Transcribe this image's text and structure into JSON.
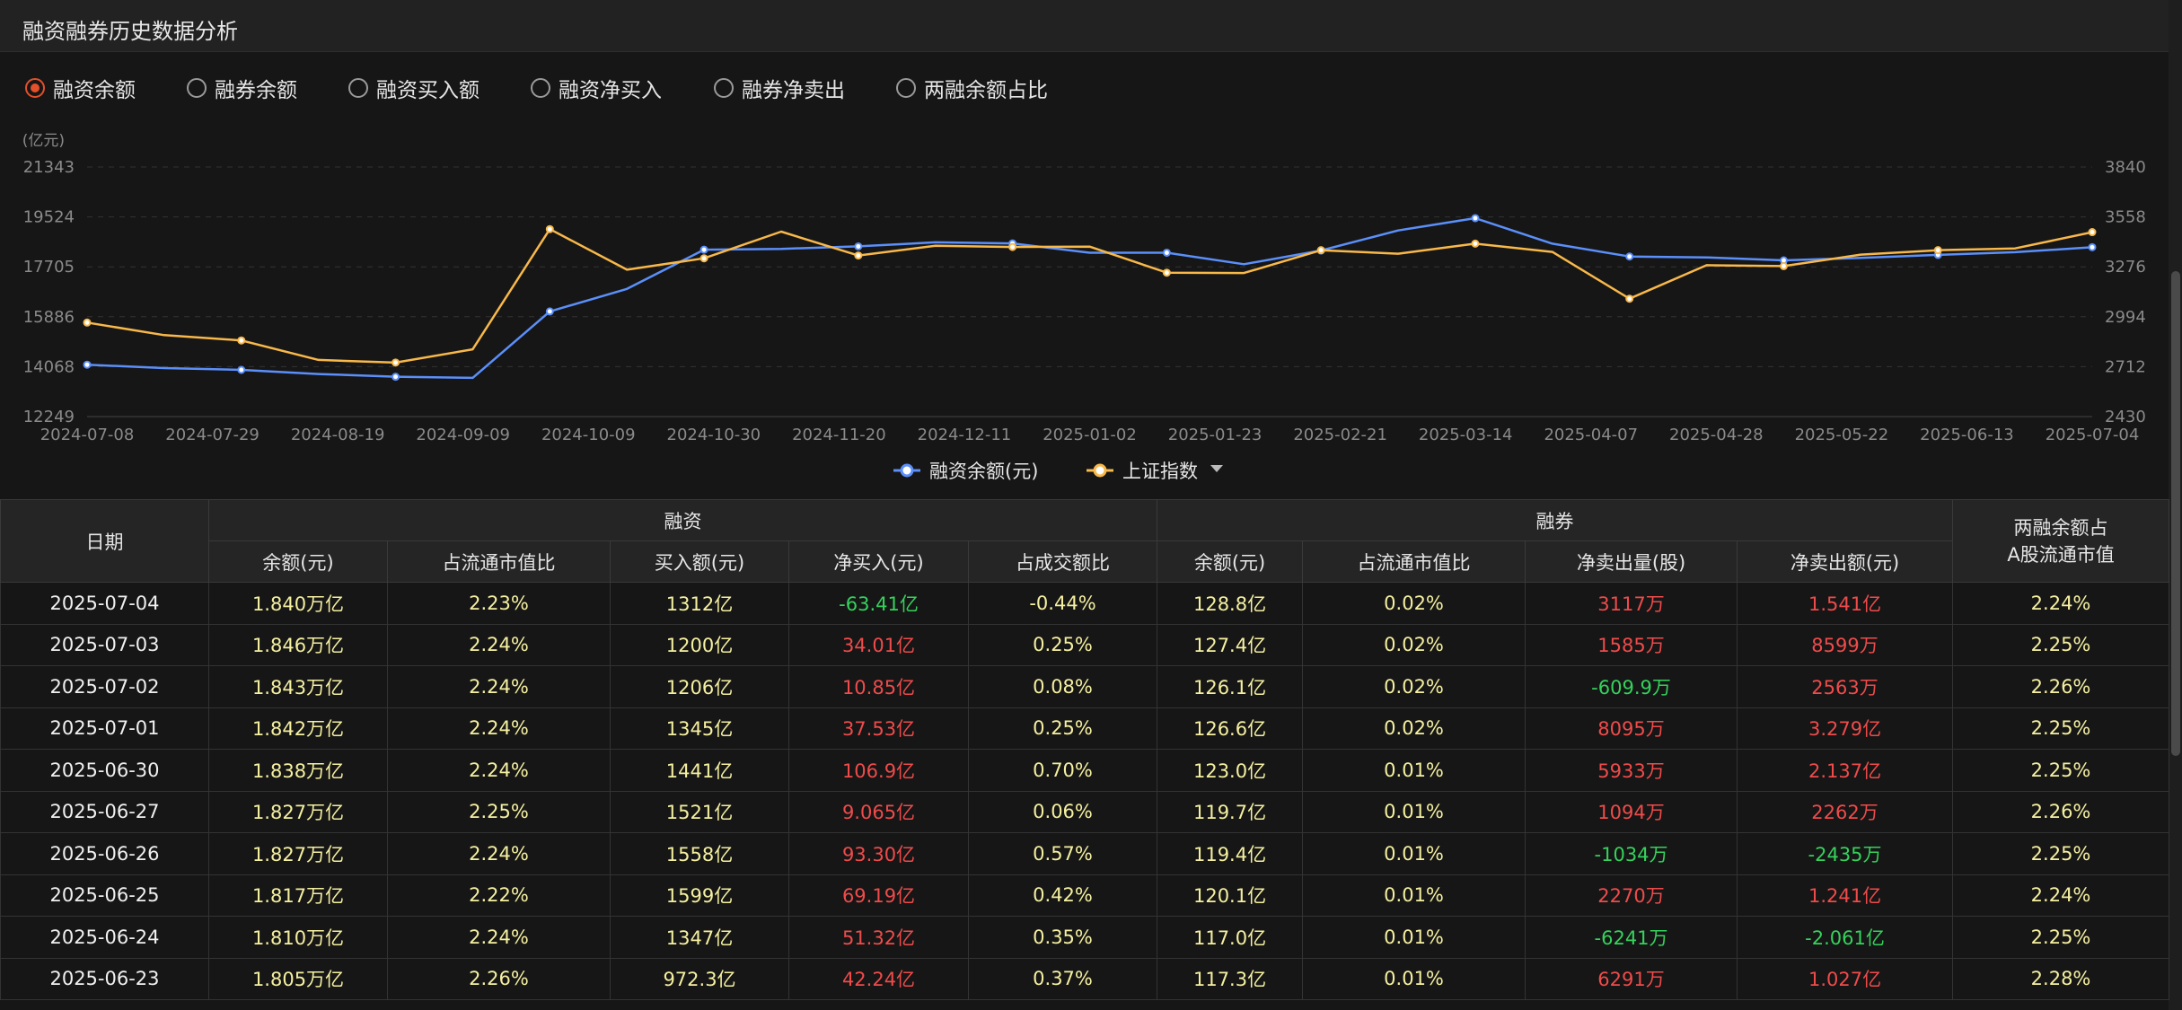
{
  "header": {
    "title": "融资融券历史数据分析"
  },
  "tabs": [
    {
      "label": "融资余额",
      "selected": true
    },
    {
      "label": "融券余额",
      "selected": false
    },
    {
      "label": "融资买入额",
      "selected": false
    },
    {
      "label": "融资净买入",
      "selected": false
    },
    {
      "label": "融券净卖出",
      "selected": false
    },
    {
      "label": "两融余额占比",
      "selected": false
    }
  ],
  "colors": {
    "accent": "#e3502a",
    "series_blue": "#5b8ff9",
    "series_orange": "#f8b84a",
    "up": "#ef4b4b",
    "down": "#35d25c",
    "value": "#f5f0a0"
  },
  "chart_data": {
    "type": "line",
    "y_unit": "(亿元)",
    "y_left_ticks": [
      "21343",
      "19524",
      "17705",
      "15886",
      "14068",
      "12249"
    ],
    "y_left_range": [
      12249,
      21343
    ],
    "y_right_ticks": [
      "3840",
      "3558",
      "3276",
      "2994",
      "2712",
      "2430"
    ],
    "y_right_range": [
      2430,
      3840
    ],
    "x_tick_labels": [
      "2024-07-08",
      "2024-07-29",
      "2024-08-19",
      "2024-09-09",
      "2024-10-09",
      "2024-10-30",
      "2024-11-20",
      "2024-12-11",
      "2025-01-02",
      "2025-01-23",
      "2025-02-21",
      "2025-03-14",
      "2025-04-07",
      "2025-04-28",
      "2025-05-22",
      "2025-06-13",
      "2025-07-04"
    ],
    "legend_position": "bottom-center",
    "grid": true,
    "series": [
      {
        "name": "融资余额(元)",
        "axis": "left",
        "color": "#5b8ff9",
        "values": [
          14140,
          14015,
          13950,
          13800,
          13700,
          13660,
          16080,
          16900,
          18330,
          18360,
          18450,
          18600,
          18560,
          18220,
          18220,
          17800,
          18300,
          19030,
          19480,
          18550,
          18080,
          18050,
          17940,
          18030,
          18140,
          18240,
          18420
        ]
      },
      {
        "name": "上证指数",
        "axis": "right",
        "color": "#f8b84a",
        "values": [
          2961,
          2890,
          2860,
          2750,
          2735,
          2810,
          3489,
          3260,
          3324,
          3475,
          3340,
          3395,
          3388,
          3390,
          3243,
          3241,
          3370,
          3350,
          3407,
          3360,
          3096,
          3285,
          3280,
          3345,
          3370,
          3380,
          3472
        ]
      }
    ]
  },
  "table": {
    "group_headers": {
      "date": "日期",
      "margin_buy": "融资",
      "short_sell": "融券",
      "ratio": "两融余额占\nA股流通市值"
    },
    "sub_headers": [
      "余额(元)",
      "占流通市值比",
      "买入额(元)",
      "净买入(元)",
      "占成交额比",
      "余额(元)",
      "占流通市值比",
      "净卖出量(股)",
      "净卖出额(元)"
    ],
    "rows": [
      [
        "2025-07-04",
        "1.840万亿",
        "2.23%",
        "1312亿",
        "-63.41亿",
        "-0.44%",
        "128.8亿",
        "0.02%",
        "3117万",
        "1.541亿",
        "2.24%"
      ],
      [
        "2025-07-03",
        "1.846万亿",
        "2.24%",
        "1200亿",
        "34.01亿",
        "0.25%",
        "127.4亿",
        "0.02%",
        "1585万",
        "8599万",
        "2.25%"
      ],
      [
        "2025-07-02",
        "1.843万亿",
        "2.24%",
        "1206亿",
        "10.85亿",
        "0.08%",
        "126.1亿",
        "0.02%",
        "-609.9万",
        "2563万",
        "2.26%"
      ],
      [
        "2025-07-01",
        "1.842万亿",
        "2.24%",
        "1345亿",
        "37.53亿",
        "0.25%",
        "126.6亿",
        "0.02%",
        "8095万",
        "3.279亿",
        "2.25%"
      ],
      [
        "2025-06-30",
        "1.838万亿",
        "2.24%",
        "1441亿",
        "106.9亿",
        "0.70%",
        "123.0亿",
        "0.01%",
        "5933万",
        "2.137亿",
        "2.25%"
      ],
      [
        "2025-06-27",
        "1.827万亿",
        "2.25%",
        "1521亿",
        "9.065亿",
        "0.06%",
        "119.7亿",
        "0.01%",
        "1094万",
        "2262万",
        "2.26%"
      ],
      [
        "2025-06-26",
        "1.827万亿",
        "2.24%",
        "1558亿",
        "93.30亿",
        "0.57%",
        "119.4亿",
        "0.01%",
        "-1034万",
        "-2435万",
        "2.25%"
      ],
      [
        "2025-06-25",
        "1.817万亿",
        "2.22%",
        "1599亿",
        "69.19亿",
        "0.42%",
        "120.1亿",
        "0.01%",
        "2270万",
        "1.241亿",
        "2.24%"
      ],
      [
        "2025-06-24",
        "1.810万亿",
        "2.24%",
        "1347亿",
        "51.32亿",
        "0.35%",
        "117.0亿",
        "0.01%",
        "-6241万",
        "-2.061亿",
        "2.25%"
      ],
      [
        "2025-06-23",
        "1.805万亿",
        "2.26%",
        "972.3亿",
        "42.24亿",
        "0.37%",
        "117.3亿",
        "0.01%",
        "6291万",
        "1.027亿",
        "2.28%"
      ]
    ]
  }
}
